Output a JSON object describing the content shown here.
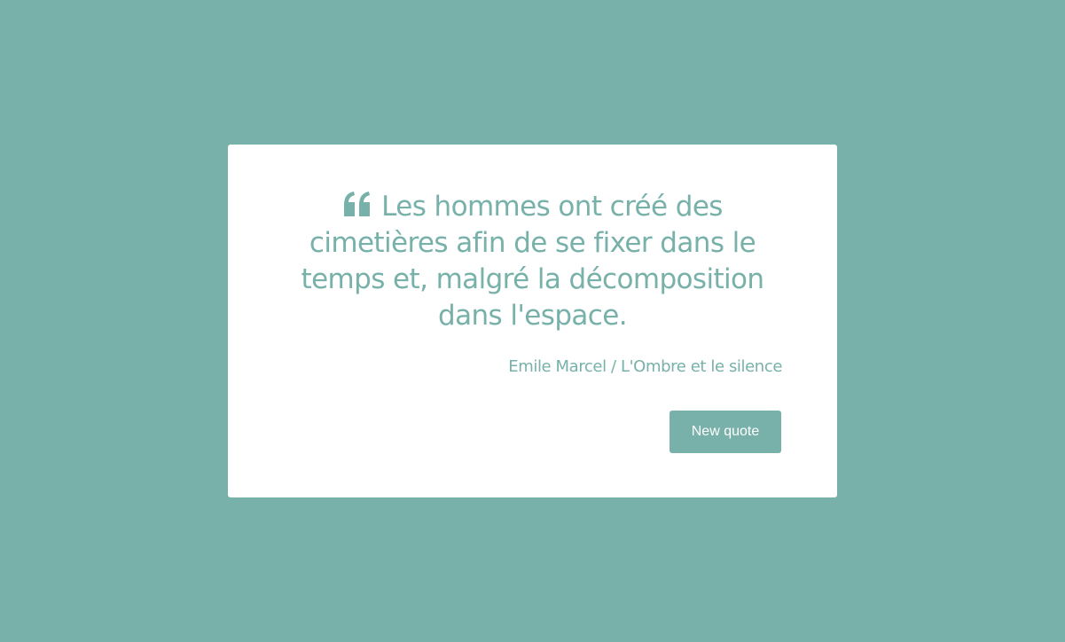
{
  "colors": {
    "background": "#77b1a9",
    "card": "#ffffff",
    "accent": "#77b1a9",
    "button_text": "#ffffff"
  },
  "quote": {
    "icon": "quote-left-icon",
    "text": "Les hommes ont créé des cimetières afin de se fixer dans le temps et, malgré la décomposition dans l'espace.",
    "author": "Emile Marcel / L'Ombre et le silence"
  },
  "actions": {
    "new_quote_label": "New quote"
  }
}
